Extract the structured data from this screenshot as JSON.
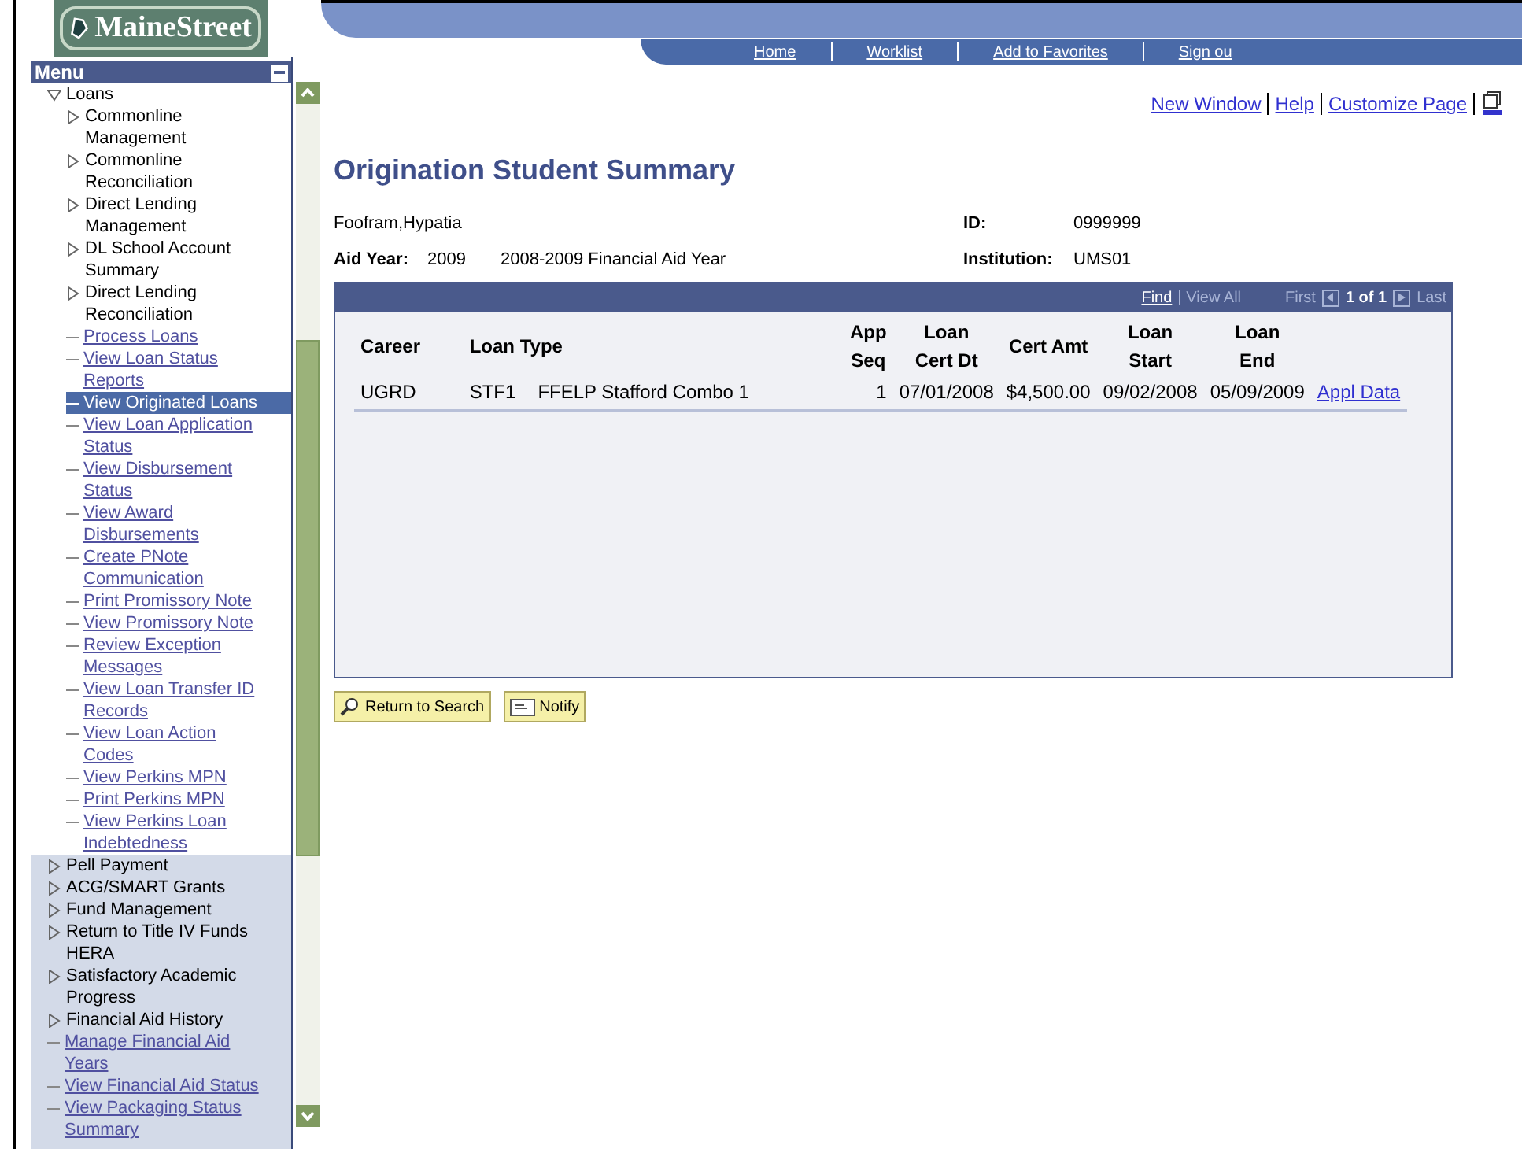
{
  "logo": {
    "text": "MaineStreet"
  },
  "top_nav": [
    "Home",
    "Worklist",
    "Add to Favorites",
    "Sign ou"
  ],
  "menu": {
    "title": "Menu",
    "items": [
      {
        "label": "Loans",
        "kind": "folder",
        "expanded": true,
        "children": [
          {
            "label": "Commonline Management",
            "kind": "folder",
            "expanded": false,
            "selected": false
          },
          {
            "label": "Commonline Reconciliation",
            "kind": "folder",
            "expanded": false,
            "selected": false
          },
          {
            "label": "Direct Lending Management",
            "kind": "folder",
            "expanded": false,
            "selected": false
          },
          {
            "label": "DL School Account Summary",
            "kind": "folder",
            "expanded": false,
            "selected": false
          },
          {
            "label": "Direct Lending Reconciliation",
            "kind": "folder",
            "expanded": false,
            "selected": false
          },
          {
            "label": "Process Loans",
            "kind": "link",
            "selected": false
          },
          {
            "label": "View Loan Status Reports",
            "kind": "link",
            "selected": false
          },
          {
            "label": "View Originated Loans",
            "kind": "link",
            "selected": true
          },
          {
            "label": "View Loan Application Status",
            "kind": "link",
            "selected": false
          },
          {
            "label": "View Disbursement Status",
            "kind": "link",
            "selected": false
          },
          {
            "label": "View Award Disbursements",
            "kind": "link",
            "selected": false
          },
          {
            "label": "Create PNote Communication",
            "kind": "link",
            "selected": false
          },
          {
            "label": "Print Promissory Note",
            "kind": "link",
            "selected": false
          },
          {
            "label": "View Promissory Note",
            "kind": "link",
            "selected": false
          },
          {
            "label": "Review Exception Messages",
            "kind": "link",
            "selected": false
          },
          {
            "label": "View Loan Transfer ID Records",
            "kind": "link",
            "selected": false
          },
          {
            "label": "View Loan Action Codes",
            "kind": "link",
            "selected": false
          },
          {
            "label": "View Perkins MPN",
            "kind": "link",
            "selected": false
          },
          {
            "label": "Print Perkins MPN",
            "kind": "link",
            "selected": false
          },
          {
            "label": "View Perkins Loan Indebtedness",
            "kind": "link",
            "selected": false
          }
        ]
      },
      {
        "label": "Pell Payment",
        "kind": "folder",
        "expanded": false
      },
      {
        "label": "ACG/SMART Grants",
        "kind": "folder",
        "expanded": false
      },
      {
        "label": "Fund Management",
        "kind": "folder",
        "expanded": false
      },
      {
        "label": "Return to Title IV Funds HERA",
        "kind": "folder",
        "expanded": false
      },
      {
        "label": "Satisfactory Academic Progress",
        "kind": "folder",
        "expanded": false
      },
      {
        "label": "Financial Aid History",
        "kind": "folder",
        "expanded": false
      },
      {
        "label": "Manage Financial Aid Years",
        "kind": "link",
        "selected": false
      },
      {
        "label": "View Financial Aid Status",
        "kind": "link",
        "selected": false
      },
      {
        "label": "View Packaging Status Summary",
        "kind": "link",
        "selected": false
      }
    ]
  },
  "page_links": [
    "New Window",
    "Help",
    "Customize Page"
  ],
  "page_title": "Origination Student Summary",
  "student": {
    "name": "Foofram,Hypatia",
    "id_label": "ID:",
    "id": "0999999",
    "aid_year_label": "Aid Year:",
    "aid_year": "2009",
    "aid_year_desc": "2008-2009 Financial Aid Year",
    "institution_label": "Institution:",
    "institution": "UMS01"
  },
  "grid": {
    "find": "Find",
    "view_all": "View All",
    "first": "First",
    "count": "1 of 1",
    "last": "Last",
    "columns": [
      "Career",
      "Loan Type",
      "App\nSeq",
      "Loan\nCert Dt",
      "Cert Amt",
      "Loan\nStart",
      "Loan\nEnd"
    ],
    "rows": [
      {
        "cells": [
          "UGRD",
          [
            "STF1",
            "FFELP Stafford Combo 1"
          ],
          "1",
          "07/01/2008",
          "$4,500.00",
          "09/02/2008",
          "05/09/2009"
        ],
        "link": "Appl Data"
      }
    ]
  },
  "buttons": [
    "Return to Search",
    "Notify"
  ]
}
